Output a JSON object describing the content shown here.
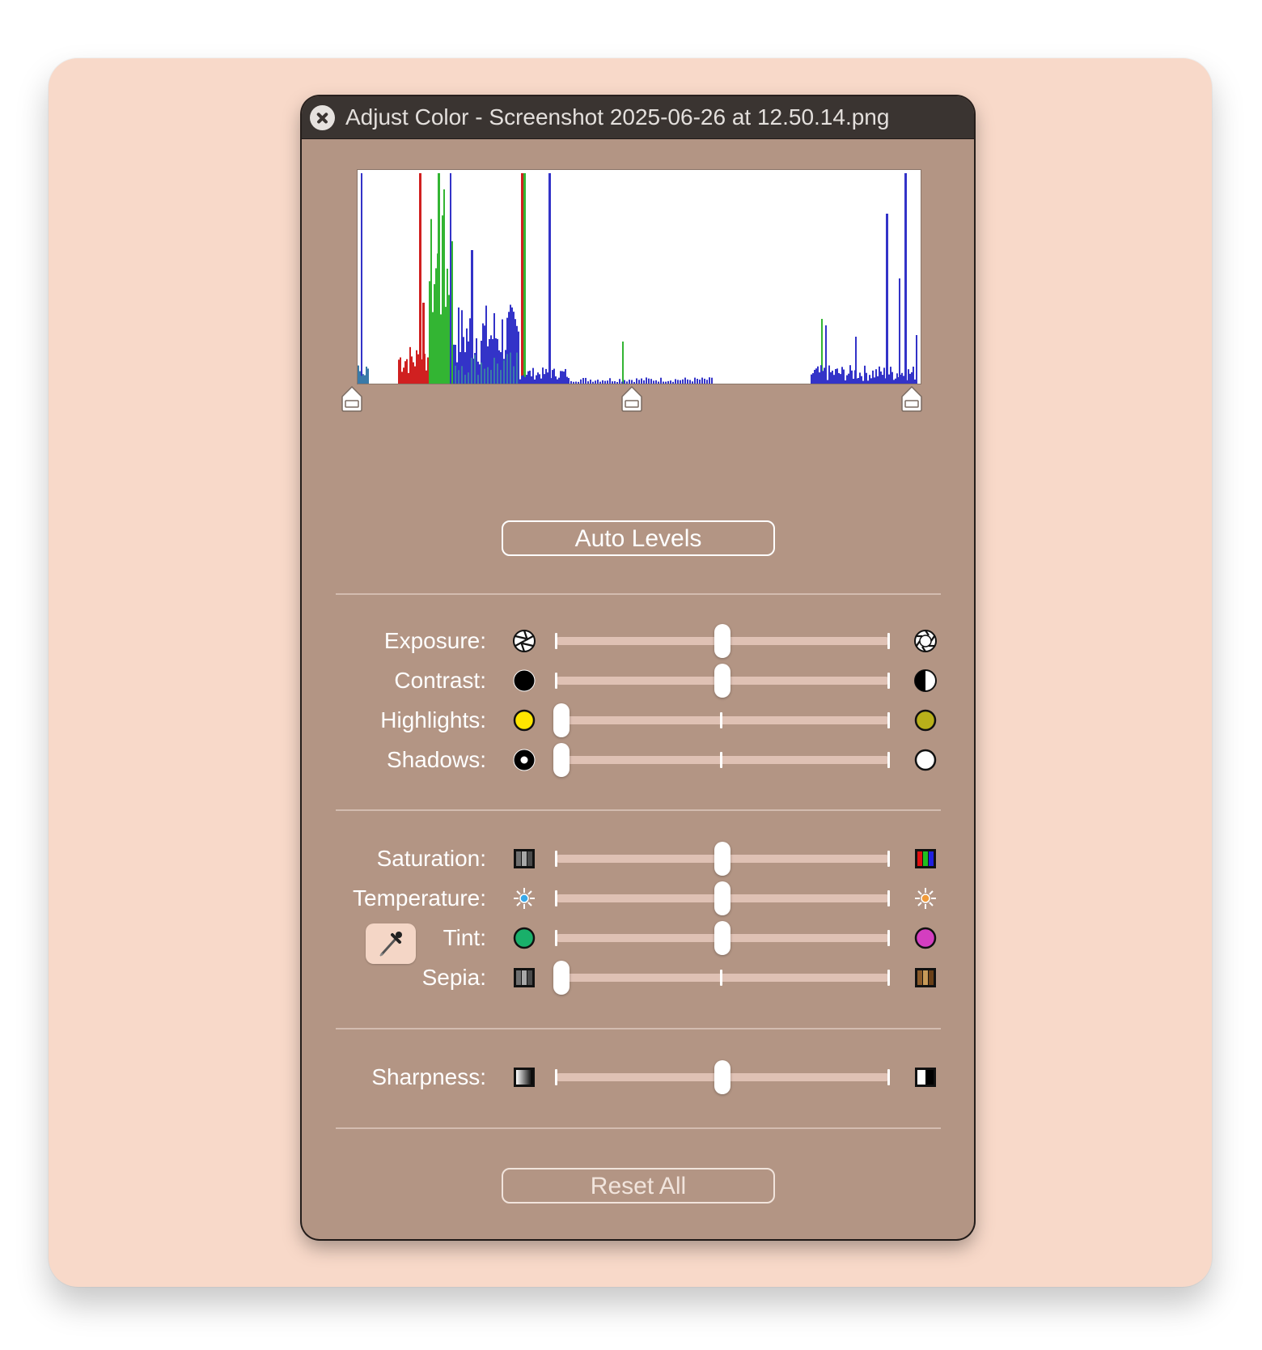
{
  "window": {
    "title": "Adjust Color - Screenshot 2025-06-26 at 12.50.14.png"
  },
  "levels": {
    "black_point": 0.0,
    "gray_point": 0.5,
    "white_point": 1.0
  },
  "buttons": {
    "auto_levels": "Auto Levels",
    "reset_all": "Reset All"
  },
  "sliders": {
    "exposure": {
      "label": "Exposure:",
      "value": 0.5,
      "left_icon": "aperture-closed-icon",
      "right_icon": "aperture-open-icon"
    },
    "contrast": {
      "label": "Contrast:",
      "value": 0.5,
      "left_icon": "black-circle-icon",
      "right_icon": "half-circle-icon"
    },
    "highlights": {
      "label": "Highlights:",
      "value": 0.0,
      "left_icon": "yellow-circle-icon",
      "right_icon": "olive-circle-icon"
    },
    "shadows": {
      "label": "Shadows:",
      "value": 0.0,
      "left_icon": "black-dot-circle-icon",
      "right_icon": "white-circle-icon"
    },
    "saturation": {
      "label": "Saturation:",
      "value": 0.5,
      "left_icon": "gray-stripes-icon",
      "right_icon": "rgb-stripes-icon"
    },
    "temperature": {
      "label": "Temperature:",
      "value": 0.5,
      "left_icon": "cool-sun-icon",
      "right_icon": "warm-sun-icon"
    },
    "tint": {
      "label": "Tint:",
      "value": 0.5,
      "left_icon": "green-circle-icon",
      "right_icon": "magenta-circle-icon"
    },
    "sepia": {
      "label": "Sepia:",
      "value": 0.0,
      "left_icon": "gray-stripes-icon",
      "right_icon": "sepia-stripes-icon"
    },
    "sharpness": {
      "label": "Sharpness:",
      "value": 0.5,
      "left_icon": "soft-gradient-icon",
      "right_icon": "sharp-edge-icon"
    }
  },
  "colors": {
    "panel_background": "#b39584",
    "backdrop": "#f8d9c9",
    "histogram_red": "#d02020",
    "histogram_green": "#33b533",
    "histogram_blue": "#3333c8",
    "histogram_mix": "#3a7aa8"
  }
}
